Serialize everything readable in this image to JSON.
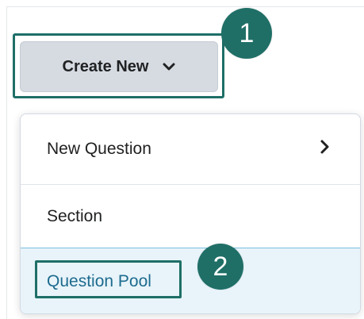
{
  "create_new": {
    "label": "Create New",
    "icon": "chevron-down-icon"
  },
  "callouts": [
    "1",
    "2"
  ],
  "menu": {
    "items": [
      {
        "label": "New Question",
        "icon": "chevron-right-icon"
      },
      {
        "label": "Section"
      },
      {
        "label": "Question Pool",
        "state": "hovered"
      }
    ]
  },
  "colors": {
    "highlight": "#1e6f67",
    "callout_badge": "#1f6f67",
    "button_bg": "#d6dbe2",
    "hover_bg": "#e8f4fa",
    "hover_text": "#1d6b8e",
    "hover_border": "#7cc0dc"
  }
}
